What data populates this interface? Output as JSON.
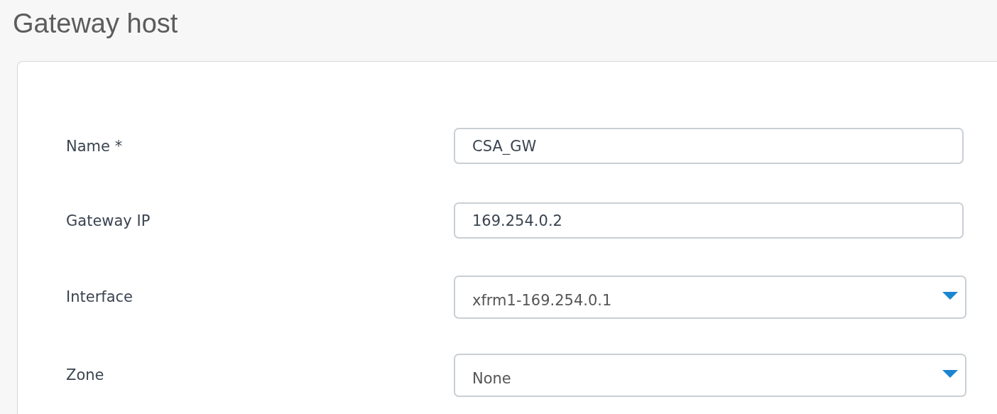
{
  "title": "Gateway host",
  "fields": [
    {
      "label": "Name *",
      "kind": "text",
      "value": "CSA_GW"
    },
    {
      "label": "Gateway IP",
      "kind": "text",
      "value": "169.254.0.2"
    },
    {
      "label": "Interface",
      "kind": "select",
      "value": "xfrm1-169.254.0.1"
    },
    {
      "label": "Zone",
      "kind": "select",
      "value": "None"
    }
  ]
}
